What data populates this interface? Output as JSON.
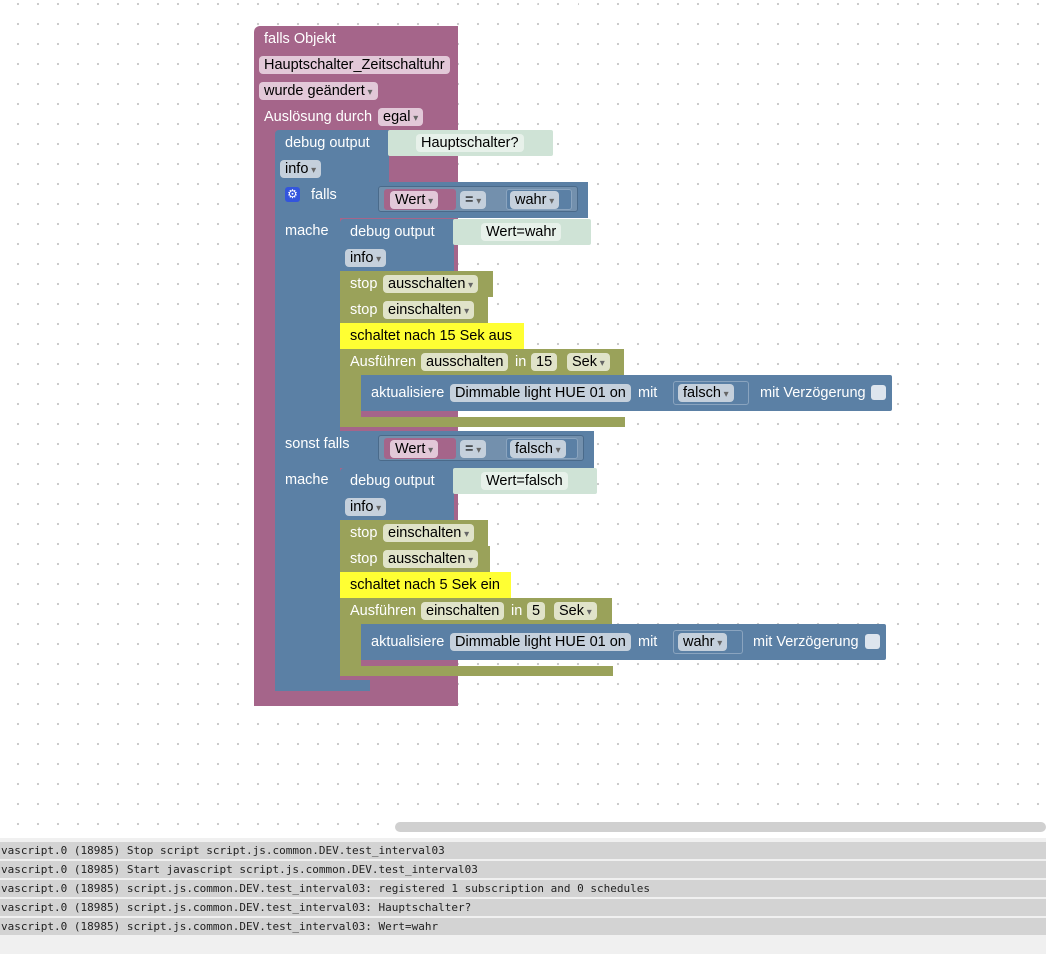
{
  "event_block": {
    "title": "falls Objekt",
    "object": "Hauptschalter_Zeitschaltuhr",
    "condition": "wurde geändert",
    "trigger_label": "Auslösung durch",
    "trigger_value": "egal"
  },
  "debug1": {
    "label": "debug output",
    "text": "Hauptschalter?",
    "level": "info"
  },
  "if_block": {
    "if_label": "falls",
    "do_label": "mache",
    "else_if_label": "sonst falls",
    "do2_label": "mache"
  },
  "cond1": {
    "var": "Wert",
    "op": "=",
    "value": "wahr"
  },
  "branch1": {
    "debug_label": "debug output",
    "debug_text": "Wert=wahr",
    "debug_level": "info",
    "stop1_label": "stop",
    "stop1_value": "ausschalten",
    "stop2_label": "stop",
    "stop2_value": "einschalten",
    "comment": "schaltet nach 15 Sek aus",
    "exec_label": "Ausführen",
    "exec_name": "ausschalten",
    "in_label": "in",
    "delay": "15",
    "unit": "Sek",
    "update_label": "aktualisiere",
    "device": "Dimmable light HUE 01 on",
    "with_label": "mit",
    "value": "falsch",
    "delay_label": "mit Verzögerung"
  },
  "cond2": {
    "var": "Wert",
    "op": "=",
    "value": "falsch"
  },
  "branch2": {
    "debug_label": "debug output",
    "debug_text": "Wert=falsch",
    "debug_level": "info",
    "stop1_label": "stop",
    "stop1_value": "einschalten",
    "stop2_label": "stop",
    "stop2_value": "ausschalten",
    "comment": "schaltet nach 5 Sek ein",
    "exec_label": "Ausführen",
    "exec_name": "einschalten",
    "in_label": "in",
    "delay": "5",
    "unit": "Sek",
    "update_label": "aktualisiere",
    "device": "Dimmable light HUE 01 on",
    "with_label": "mit",
    "value": "wahr",
    "delay_label": "mit Verzögerung"
  },
  "console": {
    "lines": [
      "vascript.0 (18985) Stop script script.js.common.DEV.test_interval03",
      "vascript.0 (18985) Start javascript script.js.common.DEV.test_interval03",
      "vascript.0 (18985) script.js.common.DEV.test_interval03: registered 1 subscription and 0 schedules",
      "vascript.0 (18985) script.js.common.DEV.test_interval03: Hauptschalter?",
      "vascript.0 (18985) script.js.common.DEV.test_interval03: Wert=wahr"
    ]
  },
  "colors": {
    "event": "#a5658a",
    "logic": "#5b80a5",
    "action": "#9aa25a",
    "comment": "#ffff33"
  }
}
